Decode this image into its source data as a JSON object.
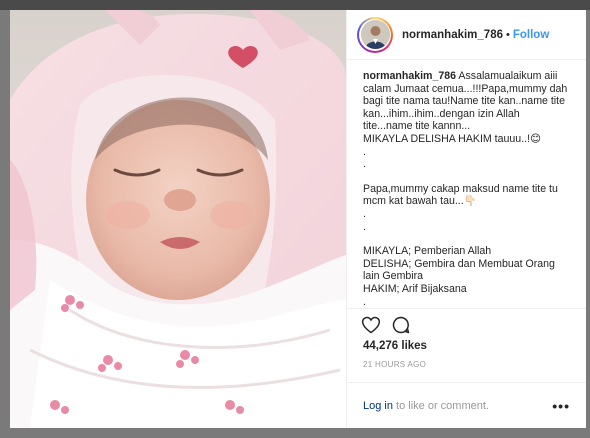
{
  "post": {
    "username": "normanhakim_786",
    "dot": "•",
    "follow_label": "Follow",
    "caption_lines": [
      "Assalamualaikum aiii calam Jumaat cemua...!!!Papa,mummy dah bagi tite nama tau!Name tite kan..name tite kan...ihim..ihim..dengan izin Allah tite...name tite kannn...",
      "MIKAYLA DELISHA HAKIM tauuu..!😊",
      ".",
      ".",
      "Papa,mummy cakap maksud name tite tu mcm kat bawah tau...👇🏻",
      ".",
      ".",
      "MIKAYLA; Pemberian Allah",
      "DELISHA; Gembira dan Membuat Orang lain Gembira",
      "HAKIM; Arif Bijaksana",
      ".",
      "."
    ],
    "likes": "44,276 likes",
    "time": "21 HOURS AGO",
    "login_label": "Log in",
    "comment_prompt": " to like or comment.",
    "more_label": "•••"
  },
  "icons": {
    "like": "heart-icon",
    "comment": "comment-icon",
    "more": "more-options-icon"
  },
  "colors": {
    "link": "#3897f0",
    "text": "#262626",
    "muted": "#999999"
  }
}
